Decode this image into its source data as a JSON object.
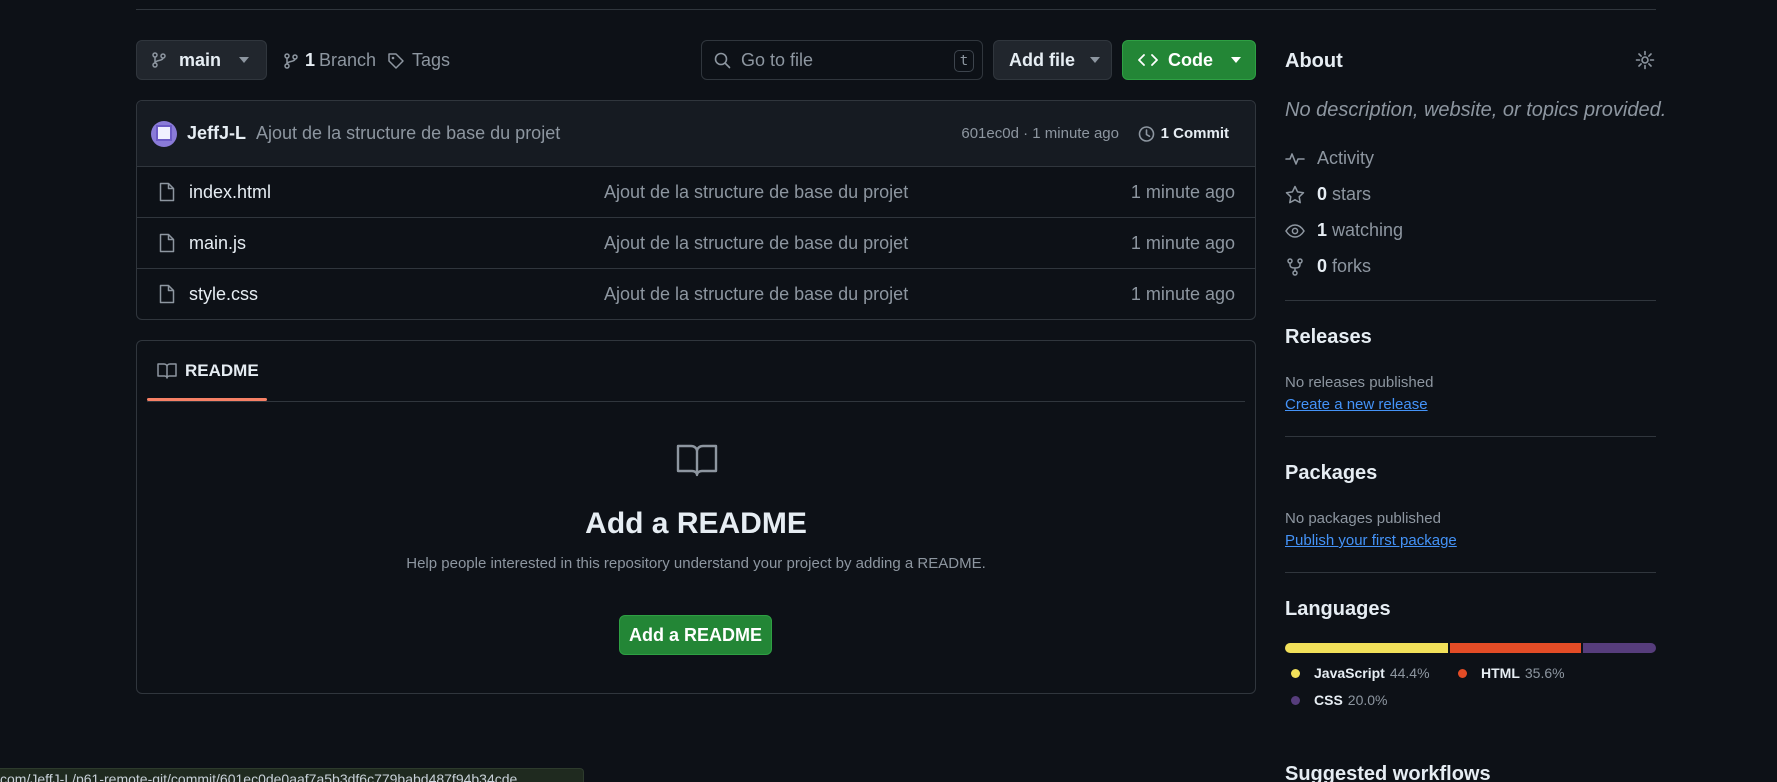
{
  "toolbar": {
    "branch_selector": "main",
    "branch_count": "1",
    "branch_label": "Branch",
    "tags_label": "Tags",
    "search_placeholder": "Go to file",
    "search_shortcut": "t",
    "add_file_label": "Add file",
    "code_label": "Code"
  },
  "latest_commit": {
    "author": "JeffJ-L",
    "message": "Ajout de la structure de base du projet",
    "meta": "601ec0d · 1 minute ago",
    "commit_count": "1 Commit"
  },
  "files": [
    {
      "name": "index.html",
      "message": "Ajout de la structure de base du projet",
      "time": "1 minute ago"
    },
    {
      "name": "main.js",
      "message": "Ajout de la structure de base du projet",
      "time": "1 minute ago"
    },
    {
      "name": "style.css",
      "message": "Ajout de la structure de base du projet",
      "time": "1 minute ago"
    }
  ],
  "readme": {
    "tab_label": "README",
    "title": "Add a README",
    "help_text": "Help people interested in this repository understand your project by adding a README.",
    "button_label": "Add a README"
  },
  "about": {
    "heading": "About",
    "description": "No description, website, or topics provided.",
    "activity_label": "Activity",
    "stars_count": "0",
    "stars_label": "stars",
    "watching_count": "1",
    "watching_label": "watching",
    "forks_count": "0",
    "forks_label": "forks"
  },
  "releases": {
    "heading": "Releases",
    "empty_text": "No releases published",
    "link": "Create a new release"
  },
  "packages": {
    "heading": "Packages",
    "empty_text": "No packages published",
    "link": "Publish your first package"
  },
  "languages": {
    "heading": "Languages",
    "items": [
      {
        "name": "JavaScript",
        "percent": "44.4%",
        "share": 44.4,
        "color": "#f1e05a"
      },
      {
        "name": "HTML",
        "percent": "35.6%",
        "share": 35.6,
        "color": "#e34c26"
      },
      {
        "name": "CSS",
        "percent": "20.0%",
        "share": 20.0,
        "color": "#563d7c"
      }
    ]
  },
  "suggested_workflows": {
    "heading": "Suggested workflows"
  },
  "status_bar": {
    "url": "com/JeffJ-L/p61-remote-git/commit/601ec0de0aaf7a5b3df6c779babd487f94b34cde"
  }
}
